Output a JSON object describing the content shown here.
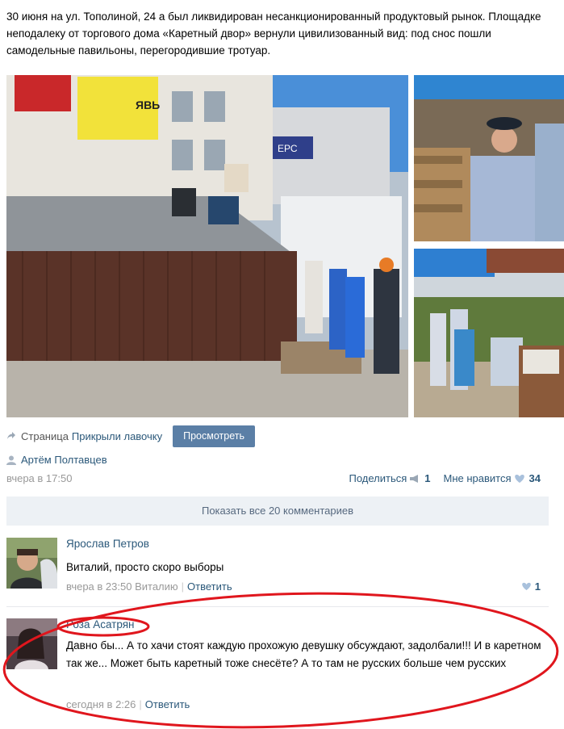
{
  "post": {
    "text": "30 июня на ул. Тополиной, 24 а был ликвидирован несанкционированный продуктовый рынок. Площадке неподалеку от торгового дома «Каретный двор» вернули цивилизованный вид: под снос пошли самодельные павильоны, перегородившие тротуар.",
    "photo_signs": {
      "sign1": "ЯВЬ",
      "sign2": "ЕРС"
    },
    "attachment": {
      "label": "Страница",
      "link": "Прикрыли лавочку",
      "button": "Просмотреть"
    },
    "author": "Артём Полтавцев",
    "time": "вчера в 17:50",
    "share_label": "Поделиться",
    "share_count": "1",
    "like_label": "Мне нравится",
    "like_count": "34",
    "show_all_comments": "Показать все 20 комментариев"
  },
  "comments": [
    {
      "name": "Ярослав Петров",
      "text": "Виталий, просто скоро выборы",
      "time": "вчера в 23:50",
      "reply_to": "Виталию",
      "reply": "Ответить",
      "likes": "1"
    },
    {
      "name": "Роза Асатрян",
      "text": "Давно бы... А то хачи стоят каждую прохожую девушку обсуждают, задолбали!!! И в каретном так же... Может быть каретный тоже снесёте? А то там не русских больше чем русских",
      "time": "сегодня в 2:26",
      "reply": "Ответить"
    }
  ],
  "colors": {
    "link": "#2b587a",
    "button": "#5b7fa6",
    "annotation": "#e0161d"
  }
}
